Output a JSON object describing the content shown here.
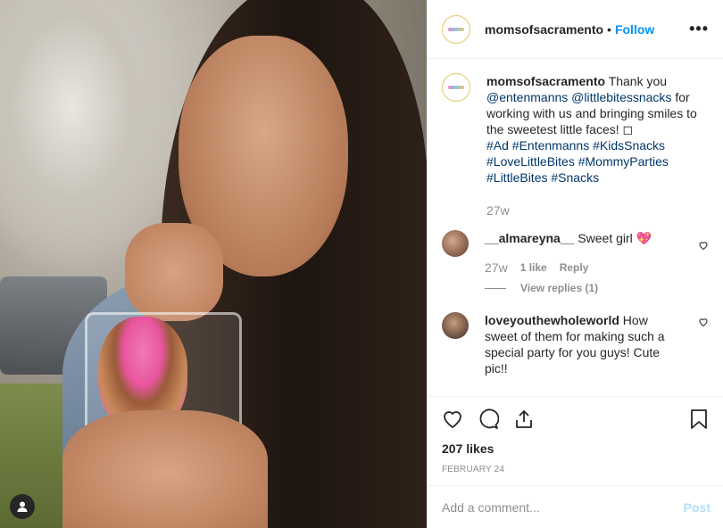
{
  "post": {
    "username": "momsofsacramento",
    "follow_label": "Follow",
    "separator": "•",
    "more_label": "•••"
  },
  "caption": {
    "username": "momsofsacramento",
    "text_1": "Thank you",
    "mention_1": "@entenmanns",
    "mention_2": "@littlebitessnacks",
    "text_2": "for working with us and bringing smiles to the sweetest little faces! ◻",
    "hashtags": "#Ad #Entenmanns #KidsSnacks #LoveLittleBites #MommyParties #LittleBites #Snacks",
    "time": "27w"
  },
  "comments": [
    {
      "username": "__almareyna__",
      "text": "Sweet girl 💖",
      "time": "27w",
      "likes": "1 like",
      "reply_label": "Reply",
      "view_replies": "View replies (1)"
    },
    {
      "username": "loveyouthewholeworld",
      "text": "How sweet of them for making such a special party for you guys! Cute pic!!"
    }
  ],
  "actions": {
    "likes": "207 likes",
    "date": "FEBRUARY 24"
  },
  "add_comment": {
    "placeholder": "Add a comment...",
    "post_label": "Post"
  },
  "colors": {
    "accent": "#0095f6",
    "text": "#262626",
    "muted": "#8e8e8e",
    "hashtag": "#00376b",
    "post_disabled": "#b2dffc"
  }
}
